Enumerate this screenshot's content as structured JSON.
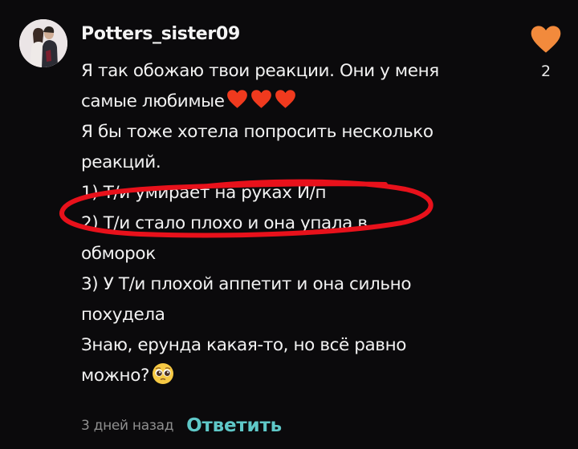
{
  "comment": {
    "username": "Potters_sister09",
    "lines": [
      "Я так обожаю твои реакции. Они у меня",
      "самые любимые",
      " Я бы тоже хотела попросить несколько",
      "реакций.",
      "1) Т/и умирает на руках И/п",
      "2) Т/и стало плохо и она упала в",
      "обморок",
      "3) У Т/и плохой аппетит и она сильно",
      "похудела",
      "Знаю, ерунда какая-то, но всё равно",
      "можно?"
    ],
    "emojis": {
      "after_line_2": [
        "red-heart",
        "red-heart",
        "red-heart"
      ],
      "after_line_11": [
        "pleading-face"
      ]
    },
    "timestamp": "3 дней назад",
    "reply_label": "Ответить",
    "like_icon": "heart-icon",
    "like_count": "2"
  },
  "colors": {
    "background": "#0b0a0c",
    "text": "#f2f2f2",
    "timestamp": "#8f8f8f",
    "reply": "#5fc8c8",
    "like_heart": "#f28a3c",
    "emoji_heart": "#f03a1e",
    "annotation": "#e8111b"
  }
}
